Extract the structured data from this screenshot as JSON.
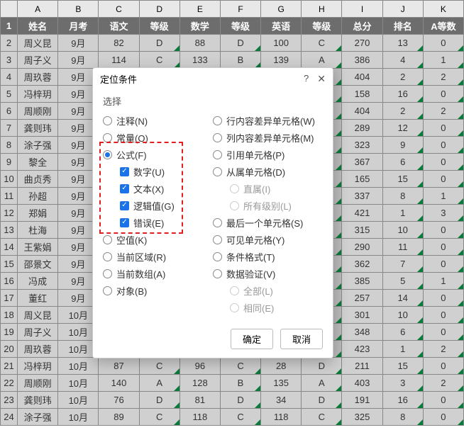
{
  "columns": [
    "",
    "A",
    "B",
    "C",
    "D",
    "E",
    "F",
    "G",
    "H",
    "I",
    "J",
    "K"
  ],
  "headers": [
    "姓名",
    "月考",
    "语文",
    "等级",
    "数学",
    "等级",
    "英语",
    "等级",
    "总分",
    "排名",
    "A等数"
  ],
  "rows": [
    {
      "n": 2,
      "c": [
        "周义昆",
        "9月",
        "82",
        "D",
        "88",
        "D",
        "100",
        "C",
        "270",
        "13",
        "0"
      ]
    },
    {
      "n": 3,
      "c": [
        "周子义",
        "9月",
        "114",
        "C",
        "133",
        "B",
        "139",
        "A",
        "386",
        "4",
        "1"
      ]
    },
    {
      "n": 4,
      "c": [
        "周玖蓉",
        "9月",
        "",
        "",
        "",
        "",
        "",
        "",
        "404",
        "2",
        "2"
      ]
    },
    {
      "n": 5,
      "c": [
        "冯梓玥",
        "9月",
        "",
        "",
        "",
        "",
        "",
        "",
        "158",
        "16",
        "0"
      ]
    },
    {
      "n": 6,
      "c": [
        "周顺刚",
        "9月",
        "",
        "",
        "",
        "",
        "",
        "",
        "404",
        "2",
        "2"
      ]
    },
    {
      "n": 7,
      "c": [
        "龚则玮",
        "9月",
        "",
        "",
        "",
        "",
        "",
        "",
        "289",
        "12",
        "0"
      ]
    },
    {
      "n": 8,
      "c": [
        "涂子强",
        "9月",
        "",
        "",
        "",
        "",
        "",
        "",
        "323",
        "9",
        "0"
      ]
    },
    {
      "n": 9,
      "c": [
        "黎全",
        "9月",
        "",
        "",
        "",
        "",
        "",
        "",
        "367",
        "6",
        "0"
      ]
    },
    {
      "n": 10,
      "c": [
        "曲贞秀",
        "9月",
        "",
        "",
        "",
        "",
        "",
        "",
        "165",
        "15",
        "0"
      ]
    },
    {
      "n": 11,
      "c": [
        "孙超",
        "9月",
        "",
        "",
        "",
        "",
        "",
        "",
        "337",
        "8",
        "1"
      ]
    },
    {
      "n": 12,
      "c": [
        "郑娟",
        "9月",
        "",
        "",
        "",
        "",
        "",
        "",
        "421",
        "1",
        "3"
      ]
    },
    {
      "n": 13,
      "c": [
        "杜海",
        "9月",
        "",
        "",
        "",
        "",
        "",
        "",
        "315",
        "10",
        "0"
      ]
    },
    {
      "n": 14,
      "c": [
        "王紫娟",
        "9月",
        "",
        "",
        "",
        "",
        "",
        "",
        "290",
        "11",
        "0"
      ]
    },
    {
      "n": 15,
      "c": [
        "邵景文",
        "9月",
        "",
        "",
        "",
        "",
        "",
        "",
        "362",
        "7",
        "0"
      ]
    },
    {
      "n": 16,
      "c": [
        "冯成",
        "9月",
        "",
        "",
        "",
        "",
        "",
        "",
        "385",
        "5",
        "1"
      ]
    },
    {
      "n": 17,
      "c": [
        "董红",
        "9月",
        "",
        "",
        "",
        "",
        "",
        "",
        "257",
        "14",
        "0"
      ]
    },
    {
      "n": 18,
      "c": [
        "周义昆",
        "10月",
        "",
        "",
        "",
        "",
        "",
        "",
        "301",
        "10",
        "0"
      ]
    },
    {
      "n": 19,
      "c": [
        "周子义",
        "10月",
        "",
        "",
        "",
        "",
        "",
        "",
        "348",
        "6",
        "0"
      ]
    },
    {
      "n": 20,
      "c": [
        "周玖蓉",
        "10月",
        "",
        "",
        "",
        "",
        "",
        "",
        "423",
        "1",
        "2"
      ]
    },
    {
      "n": 21,
      "c": [
        "冯梓玥",
        "10月",
        "87",
        "C",
        "96",
        "C",
        "28",
        "D",
        "211",
        "15",
        "0"
      ]
    },
    {
      "n": 22,
      "c": [
        "周顺刚",
        "10月",
        "140",
        "A",
        "128",
        "B",
        "135",
        "A",
        "403",
        "3",
        "2"
      ]
    },
    {
      "n": 23,
      "c": [
        "龚则玮",
        "10月",
        "76",
        "D",
        "81",
        "D",
        "34",
        "D",
        "191",
        "16",
        "0"
      ]
    },
    {
      "n": 24,
      "c": [
        "涂子强",
        "10月",
        "89",
        "C",
        "118",
        "C",
        "118",
        "C",
        "325",
        "8",
        "0"
      ]
    }
  ],
  "triCols": [
    3,
    5,
    7,
    9,
    10
  ],
  "dialog": {
    "title": "定位条件",
    "help": "?",
    "close": "✕",
    "section": "选择",
    "left": [
      {
        "type": "radio",
        "label": "注释(N)",
        "k": "note"
      },
      {
        "type": "radio",
        "label": "常量(O)",
        "k": "const"
      },
      {
        "type": "radio",
        "label": "公式(F)",
        "k": "formula",
        "checked": true
      },
      {
        "type": "check",
        "label": "数字(U)",
        "k": "num",
        "checked": true,
        "sub": true
      },
      {
        "type": "check",
        "label": "文本(X)",
        "k": "text",
        "checked": true,
        "sub": true
      },
      {
        "type": "check",
        "label": "逻辑值(G)",
        "k": "logic",
        "checked": true,
        "sub": true
      },
      {
        "type": "check",
        "label": "错误(E)",
        "k": "err",
        "checked": true,
        "sub": true
      },
      {
        "type": "radio",
        "label": "空值(K)",
        "k": "blank"
      },
      {
        "type": "radio",
        "label": "当前区域(R)",
        "k": "region"
      },
      {
        "type": "radio",
        "label": "当前数组(A)",
        "k": "array"
      },
      {
        "type": "radio",
        "label": "对象(B)",
        "k": "obj"
      }
    ],
    "right": [
      {
        "type": "radio",
        "label": "行内容差异单元格(W)",
        "k": "rowdiff"
      },
      {
        "type": "radio",
        "label": "列内容差异单元格(M)",
        "k": "coldiff"
      },
      {
        "type": "radio",
        "label": "引用单元格(P)",
        "k": "prec"
      },
      {
        "type": "radio",
        "label": "从属单元格(D)",
        "k": "dep"
      },
      {
        "type": "radio",
        "label": "直属(I)",
        "k": "direct",
        "sub": true,
        "disabled": true
      },
      {
        "type": "radio",
        "label": "所有级别(L)",
        "k": "alllev",
        "sub": true,
        "disabled": true
      },
      {
        "type": "radio",
        "label": "最后一个单元格(S)",
        "k": "last"
      },
      {
        "type": "radio",
        "label": "可见单元格(Y)",
        "k": "vis"
      },
      {
        "type": "radio",
        "label": "条件格式(T)",
        "k": "cf"
      },
      {
        "type": "radio",
        "label": "数据验证(V)",
        "k": "dv"
      },
      {
        "type": "radio",
        "label": "全部(L)",
        "k": "all",
        "sub": true,
        "disabled": true
      },
      {
        "type": "radio",
        "label": "相同(E)",
        "k": "same",
        "sub": true,
        "disabled": true
      }
    ],
    "ok": "确定",
    "cancel": "取消"
  }
}
